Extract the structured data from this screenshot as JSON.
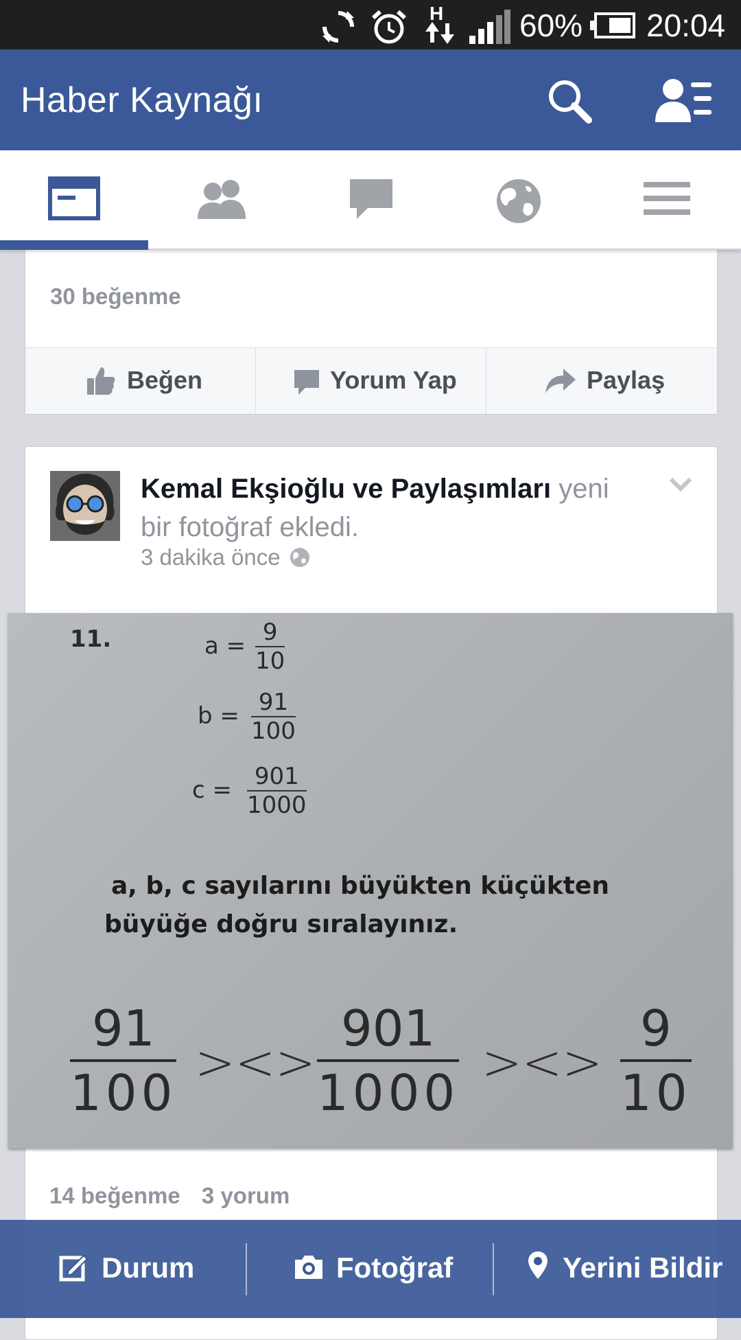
{
  "status_bar": {
    "battery_percent": "60%",
    "time": "20:04",
    "network_type": "H",
    "icons": [
      "sync-icon",
      "alarm-icon",
      "network-data-icon",
      "signal-icon",
      "battery-icon"
    ]
  },
  "header": {
    "title": "Haber Kaynağı",
    "icons": [
      "search-icon",
      "friend-requests-icon"
    ]
  },
  "tabs": [
    {
      "name": "news-feed",
      "icon": "news-feed-icon",
      "active": true
    },
    {
      "name": "friends",
      "icon": "friends-icon",
      "active": false
    },
    {
      "name": "messages",
      "icon": "messages-icon",
      "active": false
    },
    {
      "name": "notifications",
      "icon": "globe-icon",
      "active": false
    },
    {
      "name": "more",
      "icon": "menu-icon",
      "active": false
    }
  ],
  "previous_post": {
    "likes": "30 beğenme",
    "actions": {
      "like": "Beğen",
      "comment": "Yorum Yap",
      "share": "Paylaş"
    }
  },
  "post": {
    "author": "Kemal Ekşioğlu ve Paylaşımları",
    "action_text": "yeni bir fotoğraf ekledi.",
    "time": "3 dakika önce",
    "photo": {
      "number": "11.",
      "a_label": "a =",
      "a_num": "9",
      "a_den": "10",
      "b_label": "b =",
      "b_num": "91",
      "b_den": "100",
      "c_label": "c =",
      "c_num": "901",
      "c_den": "1000",
      "question": "a, b, c sayılarını büyükten küçükten büyüğe doğru sıralayınız.",
      "answer": {
        "f1_num": "91",
        "f1_den": "100",
        "sym1": "><>",
        "f2_num": "901",
        "f2_den": "1000",
        "sym2": "><>",
        "f3_num": "9",
        "f3_den": "10"
      }
    },
    "likes": "14 beğenme",
    "comments": "3 yorum"
  },
  "publisher": {
    "status": "Durum",
    "photo": "Fotoğraf",
    "checkin": "Yerini Bildir"
  },
  "colors": {
    "brand": "#3b5998",
    "status_bar": "#1e1f21",
    "feed_bg": "#d9dbe0",
    "muted_text": "#90949c"
  }
}
